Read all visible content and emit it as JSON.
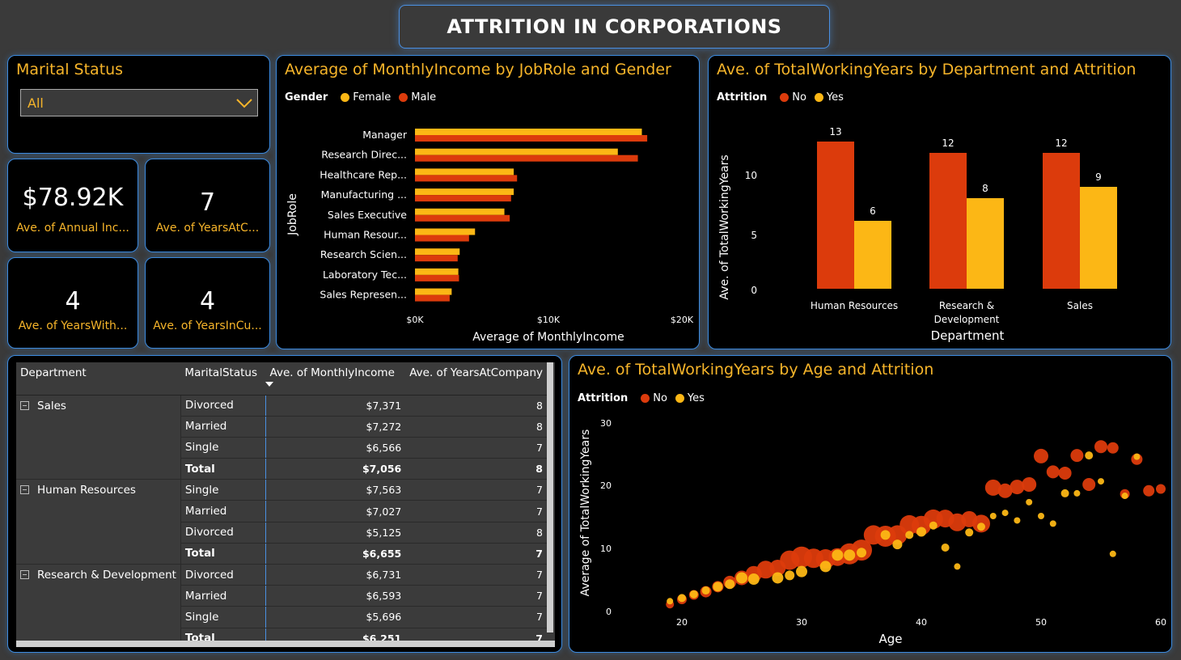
{
  "page_title": "ATTRITION IN CORPORATIONS",
  "colors": {
    "accent": "#f7b52a",
    "red": "#dc3b0c",
    "yellow": "#fcb715",
    "border": "#3c8be0"
  },
  "filter": {
    "title": "Marital Status",
    "selected": "All"
  },
  "kpis": [
    {
      "value": "$78.92K",
      "label": "Ave. of Annual Inc..."
    },
    {
      "value": "7",
      "label": "Ave. of YearsAtC..."
    },
    {
      "value": "4",
      "label": "Ave. of YearsWith..."
    },
    {
      "value": "4",
      "label": "Ave. of YearsInCu..."
    }
  ],
  "income_chart": {
    "title": "Average of MonthlyIncome by JobRole and Gender",
    "legend_title": "Gender",
    "series_names": [
      "Female",
      "Male"
    ],
    "ylabel": "JobRole",
    "xlabel": "Average of MonthlyIncome",
    "ticks": [
      "$0K",
      "$10K",
      "$20K"
    ]
  },
  "dept_chart": {
    "title": "Ave. of TotalWorkingYears by Department and Attrition",
    "legend_title": "Attrition",
    "series_names": [
      "No",
      "Yes"
    ],
    "ylabel": "Ave. of TotalWorkingYears",
    "xlabel": "Department",
    "ticks": [
      "0",
      "5",
      "10"
    ]
  },
  "age_chart": {
    "title": "Ave. of TotalWorkingYears by Age and Attrition",
    "legend_title": "Attrition",
    "series_names": [
      "No",
      "Yes"
    ],
    "ylabel": "Average of TotalWorkingYears",
    "xlabel": "Age",
    "xticks": [
      "20",
      "30",
      "40",
      "50",
      "60"
    ],
    "yticks": [
      "0",
      "10",
      "20",
      "30"
    ]
  },
  "chart_data": [
    {
      "type": "bar",
      "orientation": "horizontal",
      "categories": [
        "Manager",
        "Research Direc...",
        "Healthcare Rep...",
        "Manufacturing ...",
        "Sales Executive",
        "Human Resour...",
        "Research Scien...",
        "Laboratory Tec...",
        "Sales Represen..."
      ],
      "series": [
        {
          "name": "Female",
          "values": [
            17000,
            15200,
            7400,
            7400,
            6700,
            4500,
            3350,
            3250,
            2750
          ]
        },
        {
          "name": "Male",
          "values": [
            17400,
            16700,
            7650,
            7200,
            7100,
            4050,
            3200,
            3300,
            2600
          ]
        }
      ],
      "xlim": [
        0,
        20000
      ]
    },
    {
      "type": "bar",
      "categories": [
        "Human Resources",
        "Research & Development",
        "Sales"
      ],
      "series": [
        {
          "name": "No",
          "values": [
            13,
            12,
            12
          ]
        },
        {
          "name": "Yes",
          "values": [
            6,
            8,
            9
          ]
        }
      ],
      "data_labels": [
        [
          "13",
          "6"
        ],
        [
          "12",
          "8"
        ],
        [
          "12",
          "9"
        ]
      ],
      "ylim": [
        0,
        14
      ]
    },
    {
      "type": "scatter",
      "xlim": [
        18,
        60
      ],
      "ylim": [
        0,
        30
      ],
      "series": [
        {
          "name": "No",
          "points": [
            [
              19,
              1,
              5
            ],
            [
              20,
              1.8,
              6
            ],
            [
              21,
              2.5,
              6
            ],
            [
              22,
              3,
              7
            ],
            [
              23,
              3.8,
              7
            ],
            [
              24,
              4.5,
              8
            ],
            [
              25,
              5.2,
              9
            ],
            [
              26,
              5.8,
              10
            ],
            [
              27,
              6.5,
              11
            ],
            [
              28,
              6.8,
              10
            ],
            [
              29,
              8,
              12
            ],
            [
              30,
              8.5,
              13
            ],
            [
              31,
              8.3,
              12
            ],
            [
              32,
              8.2,
              12
            ],
            [
              33,
              8.5,
              11
            ],
            [
              34,
              9,
              13
            ],
            [
              35,
              9.6,
              13
            ],
            [
              36,
              12,
              12
            ],
            [
              37,
              11.8,
              13
            ],
            [
              38,
              12,
              12
            ],
            [
              39,
              13.6,
              12
            ],
            [
              40,
              13.5,
              12
            ],
            [
              41,
              14.5,
              12
            ],
            [
              42,
              14.6,
              11
            ],
            [
              43,
              14,
              11
            ],
            [
              44,
              14.5,
              10
            ],
            [
              45,
              13.8,
              11
            ],
            [
              46,
              19.5,
              10
            ],
            [
              47,
              19,
              9
            ],
            [
              48,
              19.6,
              9
            ],
            [
              49,
              20,
              9
            ],
            [
              50,
              24.5,
              9
            ],
            [
              51,
              22,
              8
            ],
            [
              52,
              21.8,
              8
            ],
            [
              53,
              24.6,
              8
            ],
            [
              54,
              20,
              8
            ],
            [
              55,
              26,
              8
            ],
            [
              56,
              25.8,
              7
            ],
            [
              57,
              18.5,
              6
            ],
            [
              58,
              24,
              7
            ],
            [
              59,
              19,
              7
            ],
            [
              60,
              19.3,
              6
            ]
          ]
        },
        {
          "name": "Yes",
          "points": [
            [
              19,
              1.5,
              4
            ],
            [
              20,
              2,
              5
            ],
            [
              21,
              2.6,
              5
            ],
            [
              22,
              3.2,
              5
            ],
            [
              23,
              3.8,
              6
            ],
            [
              24,
              4.2,
              6
            ],
            [
              25,
              5.2,
              7
            ],
            [
              26,
              5,
              7
            ],
            [
              28,
              5.2,
              7
            ],
            [
              29,
              5.6,
              6
            ],
            [
              30,
              6.2,
              7
            ],
            [
              32,
              7,
              7
            ],
            [
              33,
              8.8,
              7
            ],
            [
              34,
              8.8,
              7
            ],
            [
              35,
              9.2,
              6
            ],
            [
              37,
              12,
              6
            ],
            [
              38,
              10.5,
              6
            ],
            [
              39,
              12,
              5
            ],
            [
              40,
              12.5,
              6
            ],
            [
              41,
              13.5,
              5
            ],
            [
              42,
              10,
              5
            ],
            [
              43,
              7,
              4
            ],
            [
              44,
              12.4,
              5
            ],
            [
              45,
              13.3,
              5
            ],
            [
              46,
              15,
              4
            ],
            [
              47,
              15.5,
              4
            ],
            [
              48,
              14.3,
              4
            ],
            [
              49,
              17.2,
              4
            ],
            [
              50,
              15,
              4
            ],
            [
              51,
              13.8,
              4
            ],
            [
              52,
              18.6,
              5
            ],
            [
              53,
              18.6,
              4
            ],
            [
              54,
              24.6,
              5
            ],
            [
              55,
              20.5,
              4
            ],
            [
              56,
              9,
              4
            ],
            [
              57,
              18.2,
              4
            ],
            [
              58,
              24.4,
              4
            ]
          ]
        }
      ]
    },
    {
      "type": "table",
      "columns": [
        "Department",
        "MaritalStatus",
        "Ave. of MonthlyIncome",
        "Ave. of YearsAtCompany"
      ],
      "groups": [
        {
          "name": "Sales",
          "rows": [
            [
              "Divorced",
              "$7,371",
              "8"
            ],
            [
              "Married",
              "$7,272",
              "8"
            ],
            [
              "Single",
              "$6,566",
              "7"
            ],
            [
              "Total",
              "$7,056",
              "8"
            ]
          ]
        },
        {
          "name": "Human Resources",
          "rows": [
            [
              "Single",
              "$7,563",
              "7"
            ],
            [
              "Married",
              "$7,027",
              "7"
            ],
            [
              "Divorced",
              "$5,125",
              "8"
            ],
            [
              "Total",
              "$6,655",
              "7"
            ]
          ]
        },
        {
          "name": "Research & Development",
          "rows": [
            [
              "Divorced",
              "$6,731",
              "7"
            ],
            [
              "Married",
              "$6,593",
              "7"
            ],
            [
              "Single",
              "$5,696",
              "7"
            ],
            [
              "Total",
              "$6,251",
              "7"
            ]
          ]
        }
      ]
    }
  ]
}
